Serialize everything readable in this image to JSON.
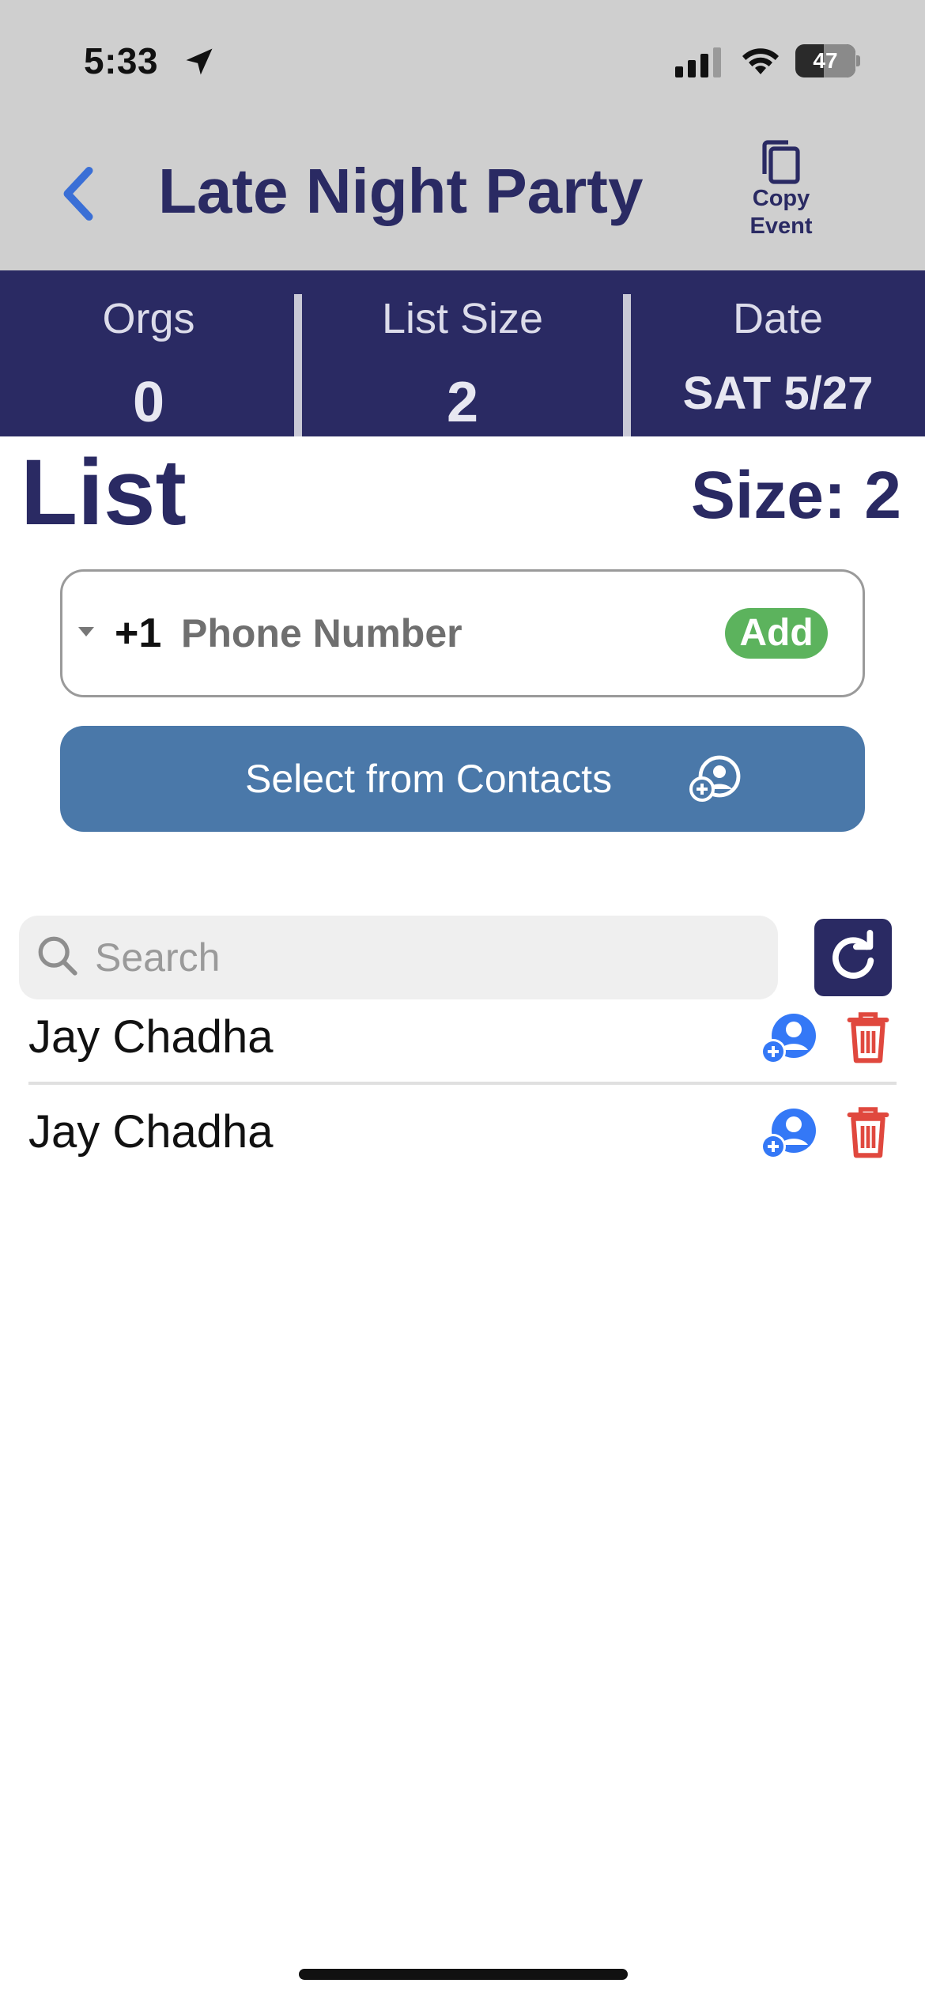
{
  "status_bar": {
    "time": "5:33",
    "battery_percent": "47",
    "battery_level": 0.47,
    "icons": [
      "location-arrow-icon",
      "cellular-signal-icon",
      "wifi-icon",
      "battery-icon"
    ]
  },
  "nav": {
    "title": "Late Night Party",
    "back_icon": "chevron-left-icon",
    "copy_event": {
      "line1": "Copy",
      "line2": "Event",
      "icon": "copy-icon"
    }
  },
  "stats": {
    "orgs": {
      "label": "Orgs",
      "value": "0"
    },
    "list_size": {
      "label": "List Size",
      "value": "2"
    },
    "date": {
      "label": "Date",
      "value": "SAT 5/27"
    }
  },
  "list": {
    "title": "List",
    "size_text": "Size: 2"
  },
  "phone_entry": {
    "country_code": "+1",
    "placeholder": "Phone Number",
    "value": "",
    "add_label": "Add"
  },
  "contacts_button": {
    "label": "Select from Contacts",
    "icon": "add-contact-icon"
  },
  "search": {
    "placeholder": "Search",
    "value": "",
    "refresh_icon": "refresh-icon"
  },
  "rows": [
    {
      "name": "Jay Chadha",
      "add_icon": "add-contact-icon",
      "delete_icon": "trash-icon"
    },
    {
      "name": "Jay Chadha",
      "add_icon": "add-contact-icon",
      "delete_icon": "trash-icon"
    }
  ],
  "colors": {
    "header_bg": "#cfcfcf",
    "navy": "#2a2a63",
    "accent_blue": "#3478f6",
    "add_green": "#5cb35d",
    "contacts_blue": "#4a78a9",
    "delete_red": "#e0483e"
  }
}
